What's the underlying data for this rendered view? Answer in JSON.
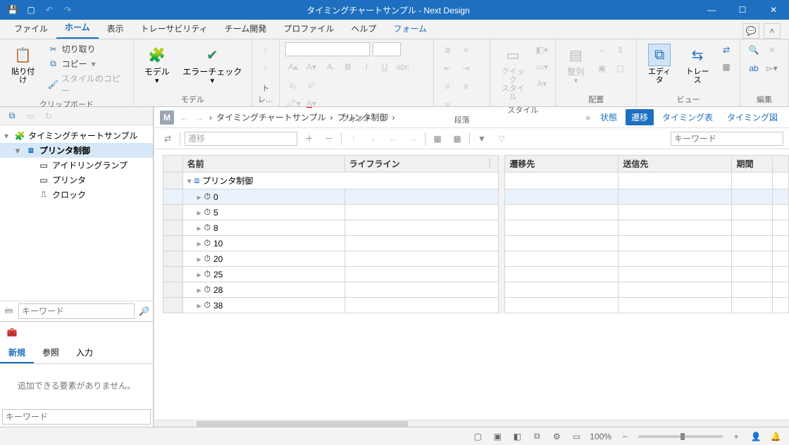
{
  "title": "タイミングチャートサンプル - Next Design",
  "tabs": [
    "ファイル",
    "ホーム",
    "表示",
    "トレーサビリティ",
    "チーム開発",
    "プロファイル",
    "ヘルプ",
    "フォーム"
  ],
  "active_tab": 1,
  "ribbon": {
    "clipboard": {
      "paste": "貼り付け",
      "cut": "切り取り",
      "copy": "コピー",
      "stylecopy": "スタイルのコピー",
      "group": "クリップボード"
    },
    "model": {
      "model": "モデル",
      "errorcheck": "エラーチェック",
      "group": "モデル"
    },
    "trace": {
      "group": "トレ…"
    },
    "font": {
      "group": "フォント"
    },
    "paragraph": {
      "group": "段落"
    },
    "style": {
      "quick": "クイック\nスタイル",
      "group": "スタイル"
    },
    "layout": {
      "align": "整列",
      "group": "配置"
    },
    "view": {
      "editor": "エディタ",
      "trace": "トレース",
      "group": "ビュー"
    },
    "edit": {
      "group": "編集"
    }
  },
  "tree": {
    "root": "タイミングチャートサンプル",
    "items": [
      {
        "label": "プリンタ制御",
        "selected": true,
        "depth": 1,
        "hasChildren": true
      },
      {
        "label": "アイドリングランプ",
        "depth": 2
      },
      {
        "label": "プリンタ",
        "depth": 2
      },
      {
        "label": "クロック",
        "depth": 2
      }
    ],
    "keyword_ph": "キーワード"
  },
  "panel2": {
    "tabs": [
      "新規",
      "参照",
      "入力"
    ],
    "active": 0,
    "msg": "追加できる要素がありません。",
    "kw_ph": "キーワード"
  },
  "breadcrumb": {
    "items": [
      "タイミングチャートサンプル",
      "プリンタ制御"
    ],
    "views": [
      "状態",
      "遷移",
      "タイミング表",
      "タイミング図"
    ],
    "active_view": 1
  },
  "grid_toolbar": {
    "combo_ph": "遷移",
    "kw_ph": "キーワード"
  },
  "grid": {
    "cols": [
      "名前",
      "ライフライン",
      "遷移先",
      "送信先",
      "期間"
    ],
    "parent": "プリンタ制御",
    "rows": [
      "0",
      "5",
      "8",
      "10",
      "20",
      "25",
      "28",
      "38"
    ]
  },
  "status": {
    "zoom": "100%"
  }
}
